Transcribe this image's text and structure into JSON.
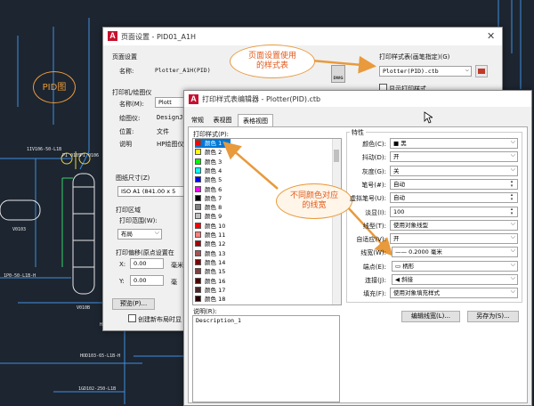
{
  "cad": {
    "labels": [
      "PID图",
      "1IV106-50-L1B",
      "PI\n0105",
      "PI\n0106",
      "V0103",
      "1P0-50-L1B-H",
      "V010B",
      "HC0103",
      "HOD103-65-L1B-H",
      "1GD102-250-L1B"
    ]
  },
  "page_setup": {
    "title": "页面设置 - PID01_A1H",
    "page_setup_heading": "页面设置",
    "name_label": "名称:",
    "name_value": "Plotter_A1H(PID)",
    "plotter_heading": "打印机/绘图仪",
    "plotter_name_label": "名称(M):",
    "plotter_name_value": "Plott",
    "plotter_label": "绘图仪:",
    "plotter_value": "DesignJ",
    "where_label": "位置:",
    "where_value": "文件",
    "desc_label": "说明",
    "desc_value": "HP绘图仪",
    "paper_heading": "图纸尺寸(Z)",
    "paper_value": "ISO A1 (841.00 x 5",
    "area_heading": "打印区域",
    "area_label": "打印范围(W):",
    "area_value": "布局",
    "offset_heading": "打印偏移(原点设置在",
    "x_label": "X:",
    "x_value": "0.00",
    "x_unit": "毫米",
    "y_label": "Y:",
    "y_value": "0.00",
    "y_unit": "毫",
    "preview_btn": "预览(P)...",
    "checkbox_label": "创建新布局时显",
    "style_table_heading": "打印样式表(画笔指定)(G)",
    "style_table_value": "Plotter(PID).ctb",
    "dwg_badge": "DWG",
    "show_styles_label": "显示打印样式"
  },
  "editor": {
    "title": "打印样式表编辑器 - Plotter(PID).ctb",
    "tabs": [
      "常规",
      "表视图",
      "表格视图"
    ],
    "styles_label": "打印样式(P):",
    "styles": [
      {
        "name": "颜色 1",
        "color": "#ff0000"
      },
      {
        "name": "颜色 2",
        "color": "#ffff00"
      },
      {
        "name": "颜色 3",
        "color": "#00ff00"
      },
      {
        "name": "颜色 4",
        "color": "#00ffff"
      },
      {
        "name": "颜色 5",
        "color": "#0000ff"
      },
      {
        "name": "颜色 6",
        "color": "#ff00ff"
      },
      {
        "name": "颜色 7",
        "color": "#000000"
      },
      {
        "name": "颜色 8",
        "color": "#808080"
      },
      {
        "name": "颜色 9",
        "color": "#c0c0c0"
      },
      {
        "name": "颜色 10",
        "color": "#ff0000"
      },
      {
        "name": "颜色 11",
        "color": "#ff7f7f"
      },
      {
        "name": "颜色 12",
        "color": "#a50000"
      },
      {
        "name": "颜色 13",
        "color": "#a55252"
      },
      {
        "name": "颜色 14",
        "color": "#7f0000"
      },
      {
        "name": "颜色 15",
        "color": "#7f3f3f"
      },
      {
        "name": "颜色 16",
        "color": "#4c0000"
      },
      {
        "name": "颜色 17",
        "color": "#4c2626"
      },
      {
        "name": "颜色 18",
        "color": "#260000"
      }
    ],
    "desc_label": "说明(R):",
    "desc_value": "Description_1",
    "props_heading": "特性",
    "color_label": "颜色(C):",
    "color_value": "■ 黑",
    "dither_label": "抖动(D):",
    "dither_value": "开",
    "gray_label": "灰度(G):",
    "gray_value": "关",
    "pen_label": "笔号(#):",
    "pen_value": "自动",
    "vpen_label": "虚拟笔号(U):",
    "vpen_value": "自动",
    "screen_label": "淡显(I):",
    "screen_value": "100",
    "linetype_label": "线型(T):",
    "linetype_value": "使用对象线型",
    "adaptive_label": "自适应(V):",
    "adaptive_value": "开",
    "lineweight_label": "线宽(W):",
    "lineweight_value": "—— 0.2000 毫米",
    "endstyle_label": "端点(E):",
    "endstyle_value": "▭ 柄形",
    "joinstyle_label": "连接(J):",
    "joinstyle_value": "◀ 斜接",
    "fill_label": "填充(F):",
    "fill_value": "使用对象填充样式",
    "edit_lw_btn": "编辑线宽(L)...",
    "save_as_btn": "另存为(S)..."
  },
  "callouts": {
    "callout1": "页面设置使用\n的样式表",
    "callout2": "不同颜色对应\n的线宽",
    "pid": "PID图"
  },
  "colors": {
    "cad_bg": "#1d2530",
    "cad_line": "#4fa8ff",
    "cad_green": "#39d26a",
    "cad_yellow": "#e8d23c",
    "accent_orange": "#e89a3c",
    "selection": "#0078d7"
  }
}
